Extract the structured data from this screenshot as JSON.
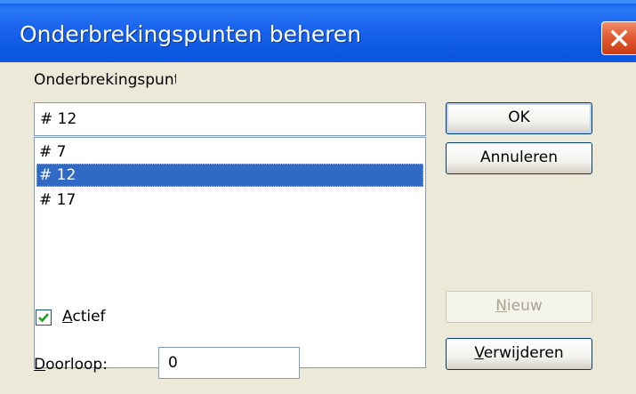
{
  "window": {
    "title": "Onderbrekingspunten beheren",
    "close_icon": "close-x-icon"
  },
  "breakpoints": {
    "list_label": "Onderbrekingspunten",
    "name_value": "# 12",
    "items": [
      {
        "label": "# 7",
        "selected": false
      },
      {
        "label": "# 12",
        "selected": true
      },
      {
        "label": "# 17",
        "selected": false
      }
    ]
  },
  "buttons": {
    "ok": "OK",
    "cancel": "Annuleren",
    "new_underlined": "N",
    "new_rest": "ieuw",
    "new_enabled": false,
    "delete_underlined": "V",
    "delete_rest": "erwijderen"
  },
  "active": {
    "checked": true,
    "label_underlined": "A",
    "label_rest": "ctief"
  },
  "passcount": {
    "label_underlined": "D",
    "label_rest": "oorloop:",
    "value": "0"
  },
  "colors": {
    "titlebar": "#0b56df",
    "selection": "#316ac5",
    "dialog_bg": "#ece9d8"
  }
}
